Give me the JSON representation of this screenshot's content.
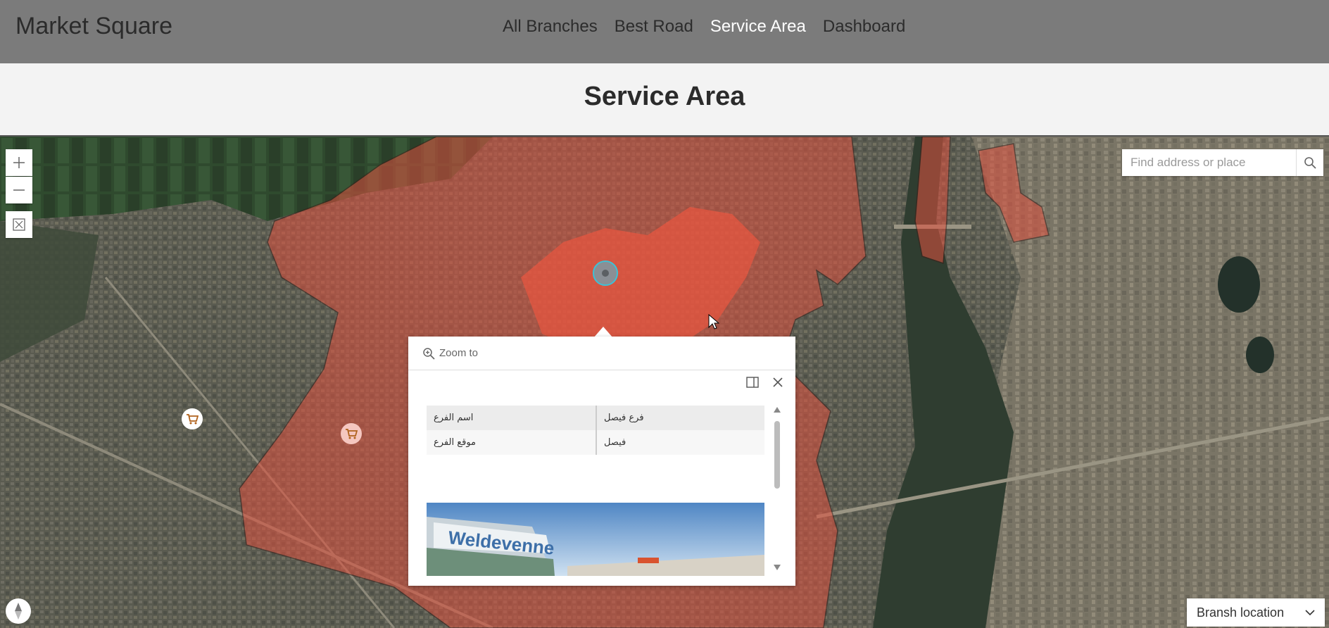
{
  "header": {
    "brand": "Market Square",
    "nav": [
      {
        "label": "All Branches",
        "active": false
      },
      {
        "label": "Best Road",
        "active": false
      },
      {
        "label": "Service Area",
        "active": true
      },
      {
        "label": "Dashboard",
        "active": false
      }
    ]
  },
  "page": {
    "title": "Service Area"
  },
  "map": {
    "zoom_in_icon": "plus-icon",
    "zoom_out_icon": "minus-icon",
    "fullscreen_icon": "expand-icon",
    "search": {
      "placeholder": "Find address or place",
      "value": ""
    },
    "basemap_selector": {
      "selected": "Bransh location"
    },
    "service_area_color": "#e0513f"
  },
  "popup": {
    "zoom_to_label": "Zoom to",
    "attributes": [
      {
        "key": "اسم الفرع",
        "value": "فرع فيصل"
      },
      {
        "key": "موقع الفرع",
        "value": "فيصل"
      }
    ],
    "photo_sign_text": "Weldevenne"
  }
}
